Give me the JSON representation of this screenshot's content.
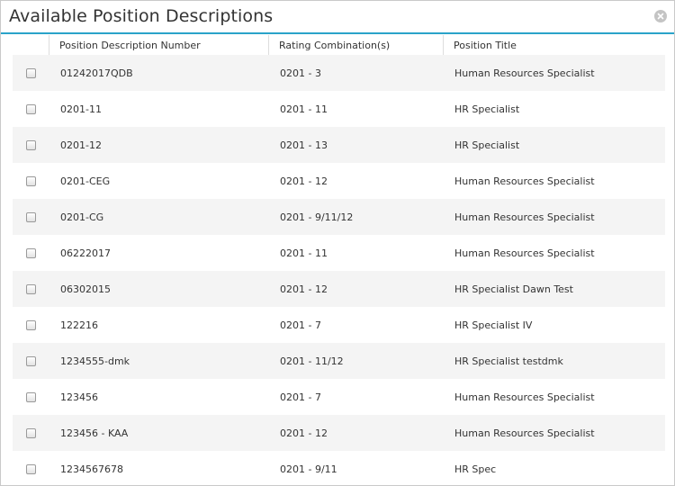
{
  "dialog": {
    "title": "Available Position Descriptions"
  },
  "table": {
    "headers": [
      "Position Description Number",
      "Rating Combination(s)",
      "Position Title"
    ],
    "rows": [
      {
        "number": "01242017QDB",
        "rating": "0201 - 3",
        "title": "Human Resources Specialist"
      },
      {
        "number": "0201-11",
        "rating": "0201 - 11",
        "title": "HR Specialist"
      },
      {
        "number": "0201-12",
        "rating": "0201 - 13",
        "title": "HR Specialist"
      },
      {
        "number": "0201-CEG",
        "rating": "0201 - 12",
        "title": "Human Resources Specialist"
      },
      {
        "number": "0201-CG",
        "rating": "0201 - 9/11/12",
        "title": "Human Resources Specialist"
      },
      {
        "number": "06222017",
        "rating": "0201 - 11",
        "title": "Human Resources Specialist"
      },
      {
        "number": "06302015",
        "rating": "0201 - 12",
        "title": "HR Specialist Dawn Test"
      },
      {
        "number": "122216",
        "rating": "0201 - 7",
        "title": "HR Specialist IV"
      },
      {
        "number": "1234555-dmk",
        "rating": "0201 - 11/12",
        "title": "HR Specialist testdmk"
      },
      {
        "number": "123456",
        "rating": "0201 - 7",
        "title": "Human Resources Specialist"
      },
      {
        "number": "123456 - KAA",
        "rating": "0201 - 12",
        "title": "Human Resources Specialist"
      },
      {
        "number": "1234567678",
        "rating": "0201 - 9/11",
        "title": "HR Spec"
      }
    ]
  }
}
